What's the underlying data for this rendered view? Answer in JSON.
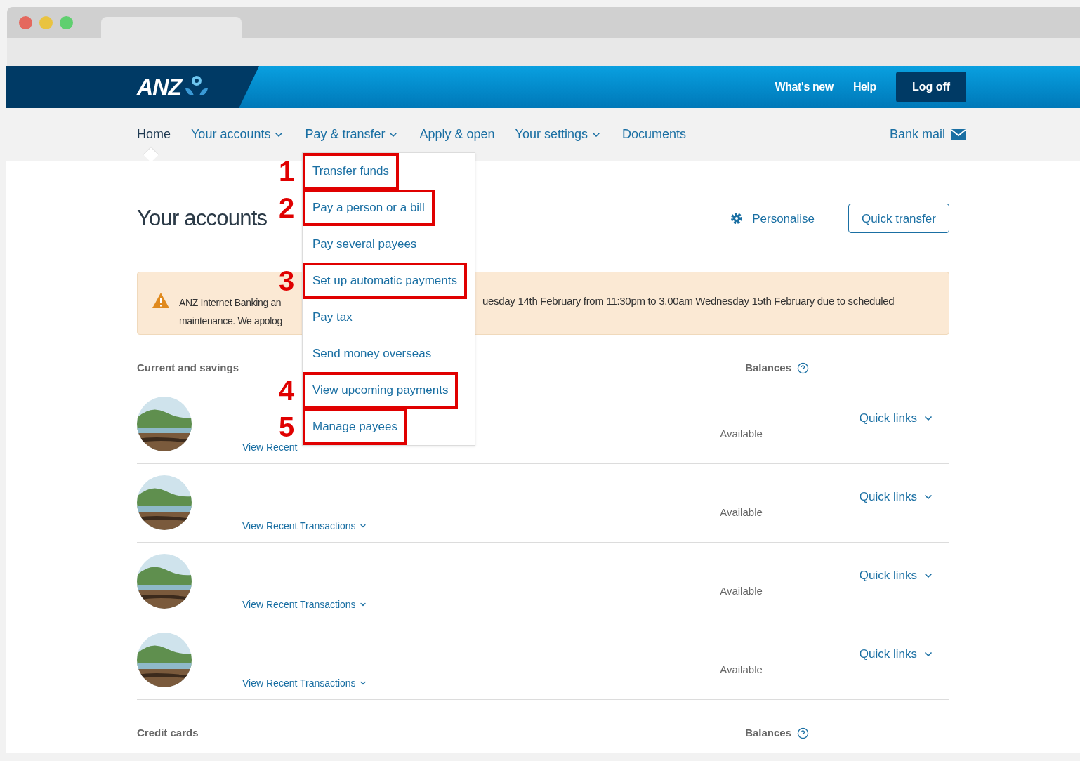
{
  "header": {
    "links": [
      "What's new",
      "Help"
    ],
    "logoff": "Log off",
    "logo": "ANZ"
  },
  "nav": {
    "items": [
      {
        "label": "Home",
        "selected": true,
        "dropdown": false
      },
      {
        "label": "Your accounts",
        "selected": false,
        "dropdown": true
      },
      {
        "label": "Pay & transfer",
        "selected": false,
        "dropdown": true
      },
      {
        "label": "Apply & open",
        "selected": false,
        "dropdown": false
      },
      {
        "label": "Your settings",
        "selected": false,
        "dropdown": true
      },
      {
        "label": "Documents",
        "selected": false,
        "dropdown": false
      }
    ],
    "bank_mail": "Bank mail"
  },
  "pay_menu": [
    {
      "label": "Transfer funds",
      "highlighted": true,
      "marker": "1"
    },
    {
      "label": "Pay a person or a bill",
      "highlighted": true,
      "marker": "2"
    },
    {
      "label": "Pay several payees",
      "highlighted": false
    },
    {
      "label": "Set up automatic payments",
      "highlighted": true,
      "marker": "3"
    },
    {
      "label": "Pay tax",
      "highlighted": false
    },
    {
      "label": "Send money overseas",
      "highlighted": false
    },
    {
      "label": "View upcoming payments",
      "highlighted": true,
      "marker": "4"
    },
    {
      "label": "Manage payees",
      "highlighted": true,
      "marker": "5"
    }
  ],
  "title": "Your accounts",
  "personalise": "Personalise",
  "quick_transfer": "Quick transfer",
  "alert": {
    "line_1_start": "ANZ Internet Banking an",
    "line_1_end": "uesday 14th February from 11:30pm to 3.00am Wednesday 15th February due to scheduled",
    "line_2_start": "maintenance. We apolog"
  },
  "sections": [
    {
      "title": "Current and savings",
      "balances": "Balances",
      "accounts": [
        {
          "link": "View Recent",
          "link_arrow": false,
          "available": "Available",
          "quick_links": "Quick links"
        },
        {
          "link": "View Recent Transactions",
          "link_arrow": true,
          "available": "Available",
          "quick_links": "Quick links"
        },
        {
          "link": "View Recent Transactions",
          "link_arrow": true,
          "available": "Available",
          "quick_links": "Quick links"
        },
        {
          "link": "View Recent Transactions",
          "link_arrow": true,
          "available": "Available",
          "quick_links": "Quick links"
        }
      ]
    },
    {
      "title": "Credit cards",
      "balances": "Balances"
    }
  ]
}
